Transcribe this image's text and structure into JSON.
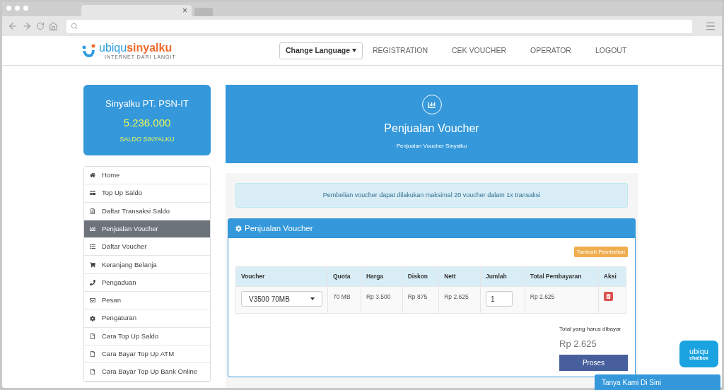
{
  "browser": {
    "tabs": [
      {
        "label": "×",
        "selected": true
      },
      {
        "selected": false
      }
    ]
  },
  "header": {
    "logo": {
      "part_1": "ubiqu",
      "part_2": "sinyalku",
      "tagline": "INTERNET DARI LANGIT"
    },
    "language": "Change Language",
    "nav": [
      "REGISTRATION",
      "CEK VOUCHER",
      "OPERATOR",
      "LOGOUT"
    ]
  },
  "account": {
    "name": "Sinyalku PT. PSN-IT",
    "balance": "5.236.000",
    "label": "SALDO SINYALKU"
  },
  "sidebar": {
    "items": [
      {
        "label": "Home",
        "selected": false
      },
      {
        "label": "Top Up Saldo",
        "selected": false
      },
      {
        "label": "Daftar Transaksi Saldo",
        "selected": false
      },
      {
        "label": "Penjualan Voucher",
        "selected": true
      },
      {
        "label": "Daftar Voucher",
        "selected": false
      },
      {
        "label": "Keranjang Belanja",
        "selected": false
      },
      {
        "label": "Pengaduan",
        "selected": false
      },
      {
        "label": "Pesan",
        "selected": false
      },
      {
        "label": "Pengaturan",
        "selected": false
      },
      {
        "label": "Cara Top Up Saldo",
        "selected": false
      },
      {
        "label": "Cara Bayar Top Up ATM",
        "selected": false
      },
      {
        "label": "Cara Bayar Top Up Bank Online",
        "selected": false
      }
    ]
  },
  "banner": {
    "title": "Penjualan Voucher",
    "subtitle": "Penjualan Voucher Sinyalku"
  },
  "alert": "Pembelian voucher dapat dilakukan maksimal 20 voucher dalam 1x transaksi",
  "panel": {
    "title": "Penjualan Voucher",
    "add_button": "Tambah Pembelian",
    "table": {
      "columns": [
        "Voucher",
        "Quota",
        "Harga",
        "Diskon",
        "Nett",
        "Jumlah",
        "Total Pembayaran",
        "Aksi"
      ],
      "rows": [
        {
          "voucher": "V3500 70MB",
          "quota": "70 MB",
          "harga": "Rp 3.500",
          "diskon": "Rp 875",
          "nett": "Rp 2.625",
          "jumlah": "1",
          "total": "Rp 2.625"
        }
      ]
    },
    "total_label": "Total yang harus dibayar",
    "total": "Rp 2.625",
    "submit": "Proses"
  },
  "chat": {
    "logo_1": "ubiqu",
    "logo_2": "chatbox",
    "button": "Tanya Kami Di Sini"
  }
}
